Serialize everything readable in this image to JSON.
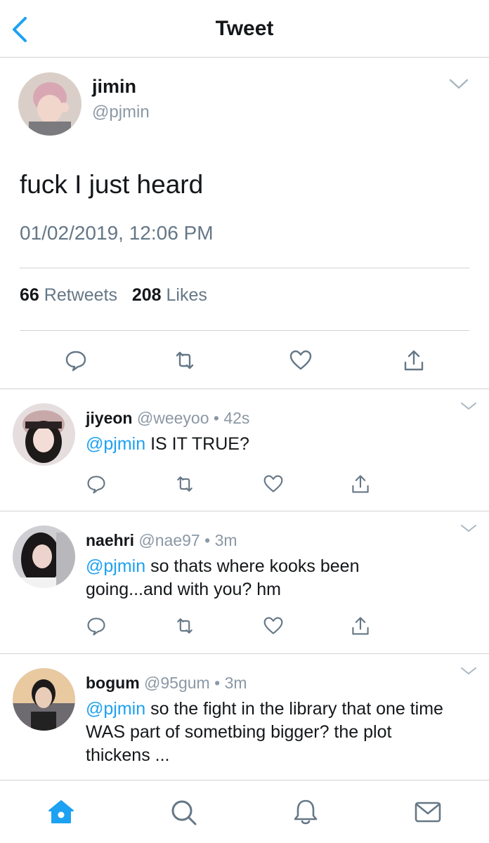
{
  "header": {
    "title": "Tweet",
    "back_icon": "chevron-left-icon",
    "accent_color": "#1da1f2"
  },
  "tweet": {
    "author_name": "jimin",
    "author_handle": "@pjmin",
    "text": "fuck I just heard",
    "timestamp": "01/02/2019, 12:06 PM",
    "retweet_count": "66",
    "retweet_label": "Retweets",
    "like_count": "208",
    "like_label": "Likes",
    "actions": [
      "reply-icon",
      "retweet-icon",
      "like-icon",
      "share-icon"
    ]
  },
  "replies": [
    {
      "name": "jiyeon",
      "handle": "@weeyoo",
      "dot": "•",
      "time": "42s",
      "mention": "@pjmin",
      "text": " IS IT TRUE?"
    },
    {
      "name": "naehri",
      "handle": "@nae97",
      "dot": "•",
      "time": "3m",
      "mention": "@pjmin",
      "text": " so thats where kooks been going...and with you? hm"
    },
    {
      "name": "bogum",
      "handle": "@95gum",
      "dot": "•",
      "time": "3m",
      "mention": "@pjmin",
      "text": " so the fight in the library that one time WAS part of sometbing bigger? the plot thickens ..."
    }
  ],
  "tabbar": {
    "items": [
      "home-icon",
      "search-icon",
      "notifications-icon",
      "messages-icon"
    ],
    "active": "home-icon"
  }
}
